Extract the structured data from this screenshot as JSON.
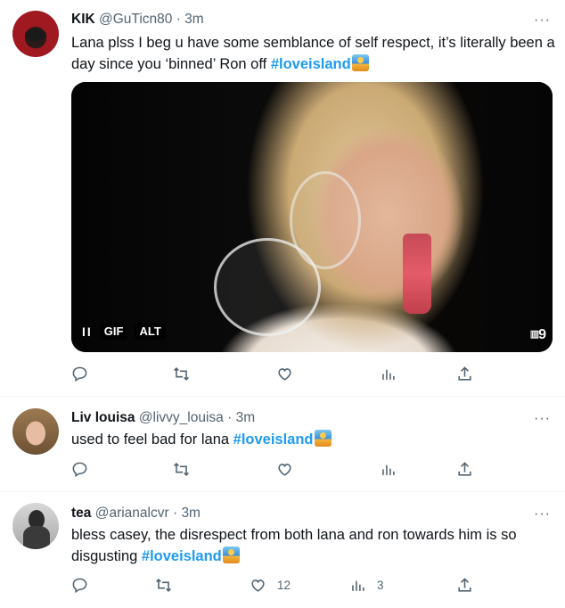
{
  "tweets": [
    {
      "name": "KIK",
      "handle": "@GuTicn80",
      "time": "3m",
      "more": "···",
      "text": "Lana plss I beg u have some semblance of self respect, it’s literally been a day since you ‘binned’ Ron off ",
      "hashtag": "#loveisland",
      "media": {
        "pause": "II",
        "gif_label": "GIF",
        "alt_label": "ALT",
        "watermark": "9"
      },
      "stats": {
        "views": ""
      }
    },
    {
      "name": "Liv louisa",
      "handle": "@livvy_louisa",
      "time": "3m",
      "more": "···",
      "text": "used to feel bad for lana  ",
      "hashtag": "#loveisland"
    },
    {
      "name": "tea",
      "handle": "@arianalcvr",
      "time": "3m",
      "more": "···",
      "text": "bless casey, the disrespect from both lana and ron towards him is so disgusting ",
      "hashtag": "#loveisland",
      "stats": {
        "likes": "12",
        "views": "3"
      }
    }
  ],
  "icons": [
    "reply-icon",
    "retweet-icon",
    "like-icon",
    "views-icon",
    "share-icon",
    "more-icon"
  ],
  "colors": {
    "link": "#1d9bf0",
    "muted": "#536471",
    "divider": "#eff3f4"
  }
}
